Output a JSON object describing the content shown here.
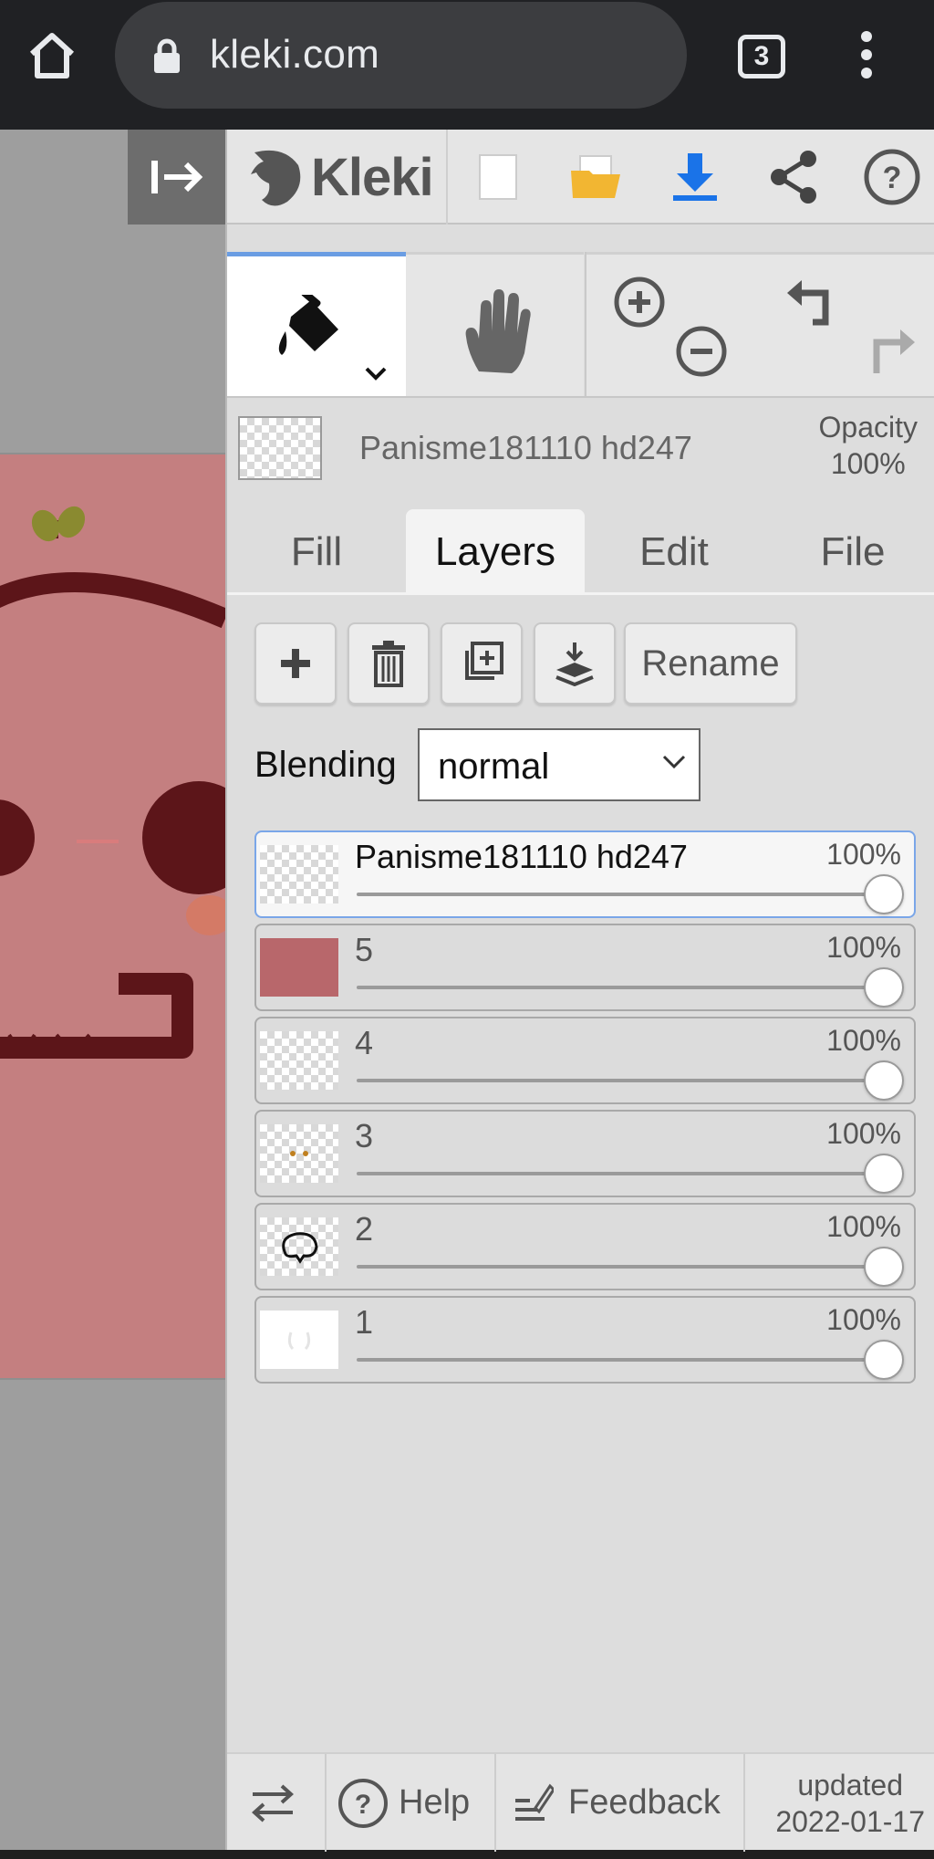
{
  "browser": {
    "url": "kleki.com",
    "tab_count": "3"
  },
  "app": {
    "logo_text": "Kleki",
    "layer_name_header": "Panisme181110 hd247",
    "opacity_label": "Opacity",
    "opacity_value": "100%",
    "tabs": [
      "Fill",
      "Layers",
      "Edit",
      "File"
    ],
    "active_tab": "Layers",
    "rename_label": "Rename",
    "blending_label": "Blending",
    "blending_value": "normal",
    "layers": [
      {
        "name": "Panisme181110 hd247",
        "opacity": "100%",
        "selected": true
      },
      {
        "name": "5",
        "opacity": "100%"
      },
      {
        "name": "4",
        "opacity": "100%"
      },
      {
        "name": "3",
        "opacity": "100%"
      },
      {
        "name": "2",
        "opacity": "100%"
      },
      {
        "name": "1",
        "opacity": "100%"
      }
    ],
    "footer": {
      "help_label": "Help",
      "feedback_label": "Feedback",
      "updated_label": "updated",
      "updated_date": "2022-01-17"
    }
  },
  "colors": {
    "accent": "#6a9de3",
    "download": "#1a73e8",
    "folder": "#f2b632",
    "artwork_bg": "#c47f80",
    "artwork_dark": "#5c1519"
  }
}
